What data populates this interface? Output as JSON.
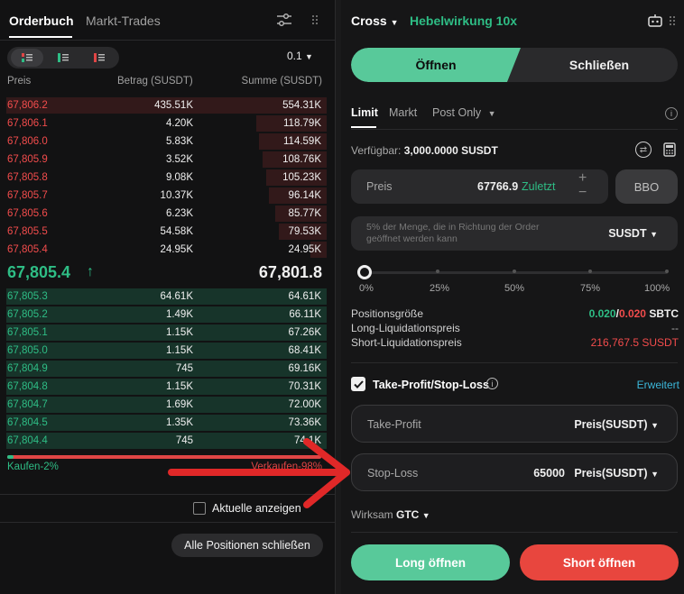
{
  "orderbook": {
    "tabs": {
      "active": "Orderbuch",
      "inactive": "Markt-Trades"
    },
    "precision": "0.1",
    "headers": {
      "price": "Preis",
      "amount": "Betrag (SUSDT)",
      "total": "Summe (SUSDT)"
    },
    "asks": [
      {
        "price": "67,806.2",
        "amount": "435.51K",
        "total": "554.31K",
        "depth": 1.0
      },
      {
        "price": "67,806.1",
        "amount": "4.20K",
        "total": "118.79K",
        "depth": 0.22
      },
      {
        "price": "67,806.0",
        "amount": "5.83K",
        "total": "114.59K",
        "depth": 0.21
      },
      {
        "price": "67,805.9",
        "amount": "3.52K",
        "total": "108.76K",
        "depth": 0.2
      },
      {
        "price": "67,805.8",
        "amount": "9.08K",
        "total": "105.23K",
        "depth": 0.19
      },
      {
        "price": "67,805.7",
        "amount": "10.37K",
        "total": "96.14K",
        "depth": 0.18
      },
      {
        "price": "67,805.6",
        "amount": "6.23K",
        "total": "85.77K",
        "depth": 0.16
      },
      {
        "price": "67,805.5",
        "amount": "54.58K",
        "total": "79.53K",
        "depth": 0.15
      },
      {
        "price": "67,805.4",
        "amount": "24.95K",
        "total": "24.95K",
        "depth": 0.05
      }
    ],
    "last_price": "67,805.4",
    "last_direction": "↑",
    "mark_price": "67,801.8",
    "bids": [
      {
        "price": "67,805.3",
        "amount": "64.61K",
        "total": "64.61K",
        "depth": 1.0
      },
      {
        "price": "67,805.2",
        "amount": "1.49K",
        "total": "66.11K",
        "depth": 1.0
      },
      {
        "price": "67,805.1",
        "amount": "1.15K",
        "total": "67.26K",
        "depth": 1.0
      },
      {
        "price": "67,805.0",
        "amount": "1.15K",
        "total": "68.41K",
        "depth": 1.0
      },
      {
        "price": "67,804.9",
        "amount": "745",
        "total": "69.16K",
        "depth": 1.0
      },
      {
        "price": "67,804.8",
        "amount": "1.15K",
        "total": "70.31K",
        "depth": 1.0
      },
      {
        "price": "67,804.7",
        "amount": "1.69K",
        "total": "72.00K",
        "depth": 1.0
      },
      {
        "price": "67,804.5",
        "amount": "1.35K",
        "total": "73.36K",
        "depth": 1.0
      },
      {
        "price": "67,804.4",
        "amount": "745",
        "total": "74.1K",
        "depth": 1.0
      }
    ],
    "buy_ratio_label": "Kaufen-2%",
    "sell_ratio_label": "Verkaufen-98%",
    "buy_ratio": 0.02,
    "show_current_label": "Aktuelle anzeigen",
    "close_all_label": "Alle Positionen schließen"
  },
  "trade": {
    "margin_mode": "Cross",
    "leverage": "Hebelwirkung 10x",
    "open_label": "Öffnen",
    "close_label": "Schließen",
    "order_types": {
      "limit": "Limit",
      "market": "Markt",
      "post_only": "Post Only"
    },
    "available_label": "Verfügbar:",
    "available_value": "3,000.0000 SUSDT",
    "price_label": "Preis",
    "price_value": "67766.9",
    "latest_label": "Zuletzt",
    "bbo_label": "BBO",
    "qty_placeholder": "5% der Menge, die in Richtung der Order geöffnet werden kann",
    "qty_unit": "SUSDT",
    "slider_labels": [
      "0%",
      "25%",
      "50%",
      "75%",
      "100%"
    ],
    "slider_value": 0,
    "position_size_label": "Positionsgröße",
    "position_size_long": "0.020",
    "position_size_sep": "/",
    "position_size_short": "0.020",
    "position_size_unit": "SBTC",
    "long_liq_label": "Long-Liquidationspreis",
    "long_liq_value": "--",
    "short_liq_label": "Short-Liquidationspreis",
    "short_liq_value": "216,767.5 SUSDT",
    "tpsl_label": "Take-Profit/Stop-Loss",
    "advanced_label": "Erweitert",
    "take_profit_label": "Take-Profit",
    "take_profit_unit": "Preis(SUSDT)",
    "stop_loss_label": "Stop-Loss",
    "stop_loss_value": "65000",
    "stop_loss_unit": "Preis(SUSDT)",
    "tif_label": "Wirksam",
    "tif_value": "GTC",
    "long_button": "Long öffnen",
    "short_button": "Short öffnen"
  },
  "colors": {
    "ask": "#f24c4c",
    "bid": "#2ebd85",
    "accent_green": "#58c99a",
    "short_red": "#e8463e",
    "link": "#3bb6d9",
    "annotation": "#e02828"
  }
}
